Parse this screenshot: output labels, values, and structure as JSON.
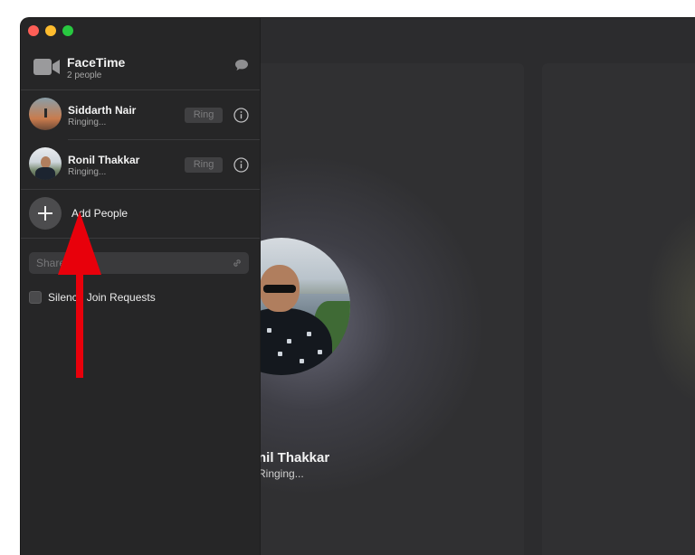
{
  "window": {
    "app_name": "FaceTime",
    "participant_count": "2 people"
  },
  "participants": [
    {
      "name": "Siddarth Nair",
      "status": "Ringing...",
      "ring_label": "Ring"
    },
    {
      "name": "Ronil Thakkar",
      "status": "Ringing...",
      "ring_label": "Ring"
    }
  ],
  "actions": {
    "add_people": "Add People",
    "share_link_placeholder": "Share Link",
    "silence_join_requests": "Silence Join Requests"
  },
  "stage": {
    "caller_name": "nil Thakkar",
    "caller_status": "Ringing..."
  },
  "icons": {
    "camera": "video-camera-icon",
    "chat": "message-bubble-icon",
    "info": "info-circle-icon",
    "plus": "plus-icon",
    "link": "link-icon"
  },
  "colors": {
    "sidebar_bg": "#262627",
    "stage_bg": "#2c2c2e",
    "annotation_arrow": "#e8000b",
    "close": "#fe5f57",
    "minimize": "#febc2e",
    "zoom": "#28c840"
  }
}
